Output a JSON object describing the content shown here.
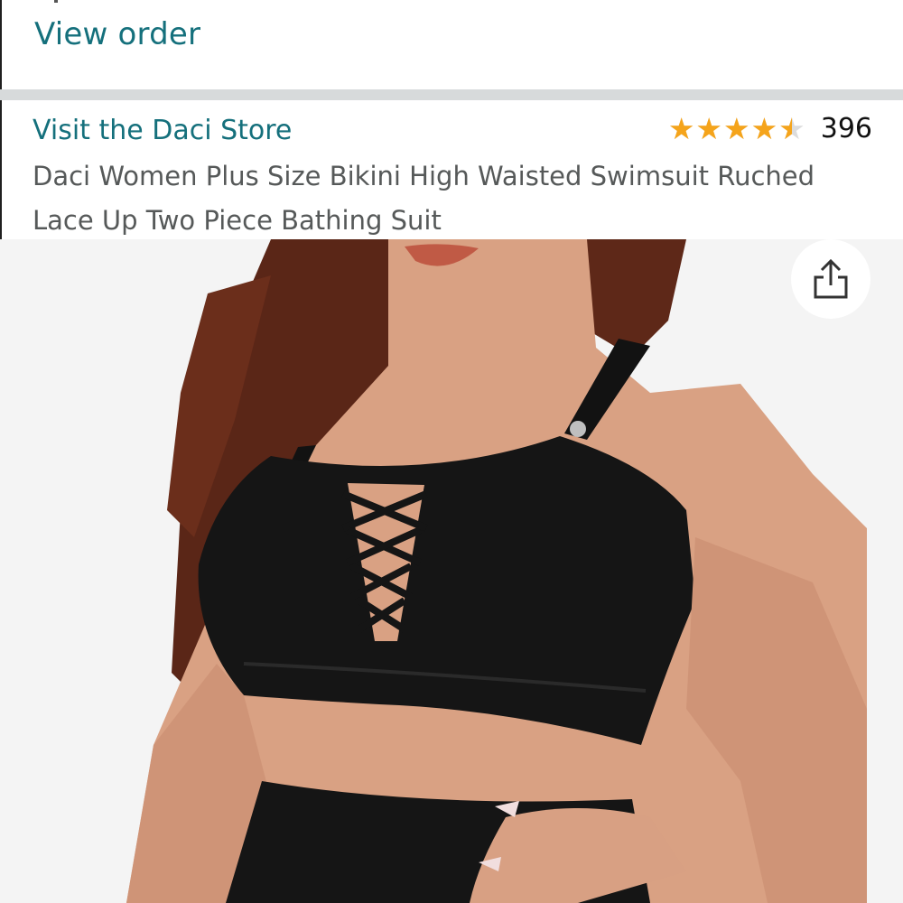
{
  "order": {
    "view_order_label": "View order"
  },
  "product": {
    "store_link": "Visit the Daci Store",
    "rating": {
      "stars": 4.5,
      "review_count": "396",
      "star_color": "#f5a41b"
    },
    "title": "Daci Women Plus Size Bikini High Waisted Swimsuit Ruched Lace Up Two Piece Bathing Suit"
  },
  "image": {
    "description_icon": "share-icon"
  },
  "colors": {
    "link": "#15707c",
    "text_secondary": "#565959",
    "divider": "#d7dadb"
  }
}
